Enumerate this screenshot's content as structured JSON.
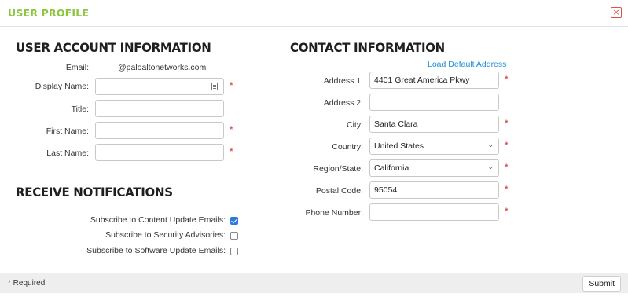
{
  "dialog": {
    "title": "USER PROFILE",
    "close_symbol": "×"
  },
  "account": {
    "heading": "USER ACCOUNT INFORMATION",
    "email_label": "Email:",
    "email_value": "@paloaltonetworks.com",
    "display_name_label": "Display Name:",
    "display_name_value": "",
    "title_label": "Title:",
    "title_value": "",
    "first_name_label": "First Name:",
    "first_name_value": "",
    "last_name_label": "Last Name:",
    "last_name_value": ""
  },
  "notifications": {
    "heading": "RECEIVE NOTIFICATIONS",
    "items": [
      {
        "label": "Subscribe to Content Update Emails:",
        "checked": true
      },
      {
        "label": "Subscribe to Security Advisories:",
        "checked": false
      },
      {
        "label": "Subscribe to Software Update Emails:",
        "checked": false
      }
    ]
  },
  "contact": {
    "heading": "CONTACT INFORMATION",
    "load_default_link": "Load Default Address",
    "address1_label": "Address 1:",
    "address1_value": "4401 Great America Pkwy",
    "address2_label": "Address 2:",
    "address2_value": "",
    "city_label": "City:",
    "city_value": "Santa Clara",
    "country_label": "Country:",
    "country_value": "United States",
    "region_label": "Region/State:",
    "region_value": "California",
    "postal_label": "Postal Code:",
    "postal_value": "95054",
    "phone_label": "Phone Number:",
    "phone_value": ""
  },
  "required_mark": "*",
  "footer": {
    "required_star": "*",
    "required_text": " Required",
    "submit_label": "Submit"
  },
  "icons": {
    "chevron": "chevron-down-icon",
    "contact_card": "contact-card-icon",
    "close": "close-icon"
  },
  "colors": {
    "title_green": "#8dc63f",
    "required_red": "#d9534f",
    "link_blue": "#1f8fd6",
    "checkbox_blue": "#2a7ae2"
  }
}
